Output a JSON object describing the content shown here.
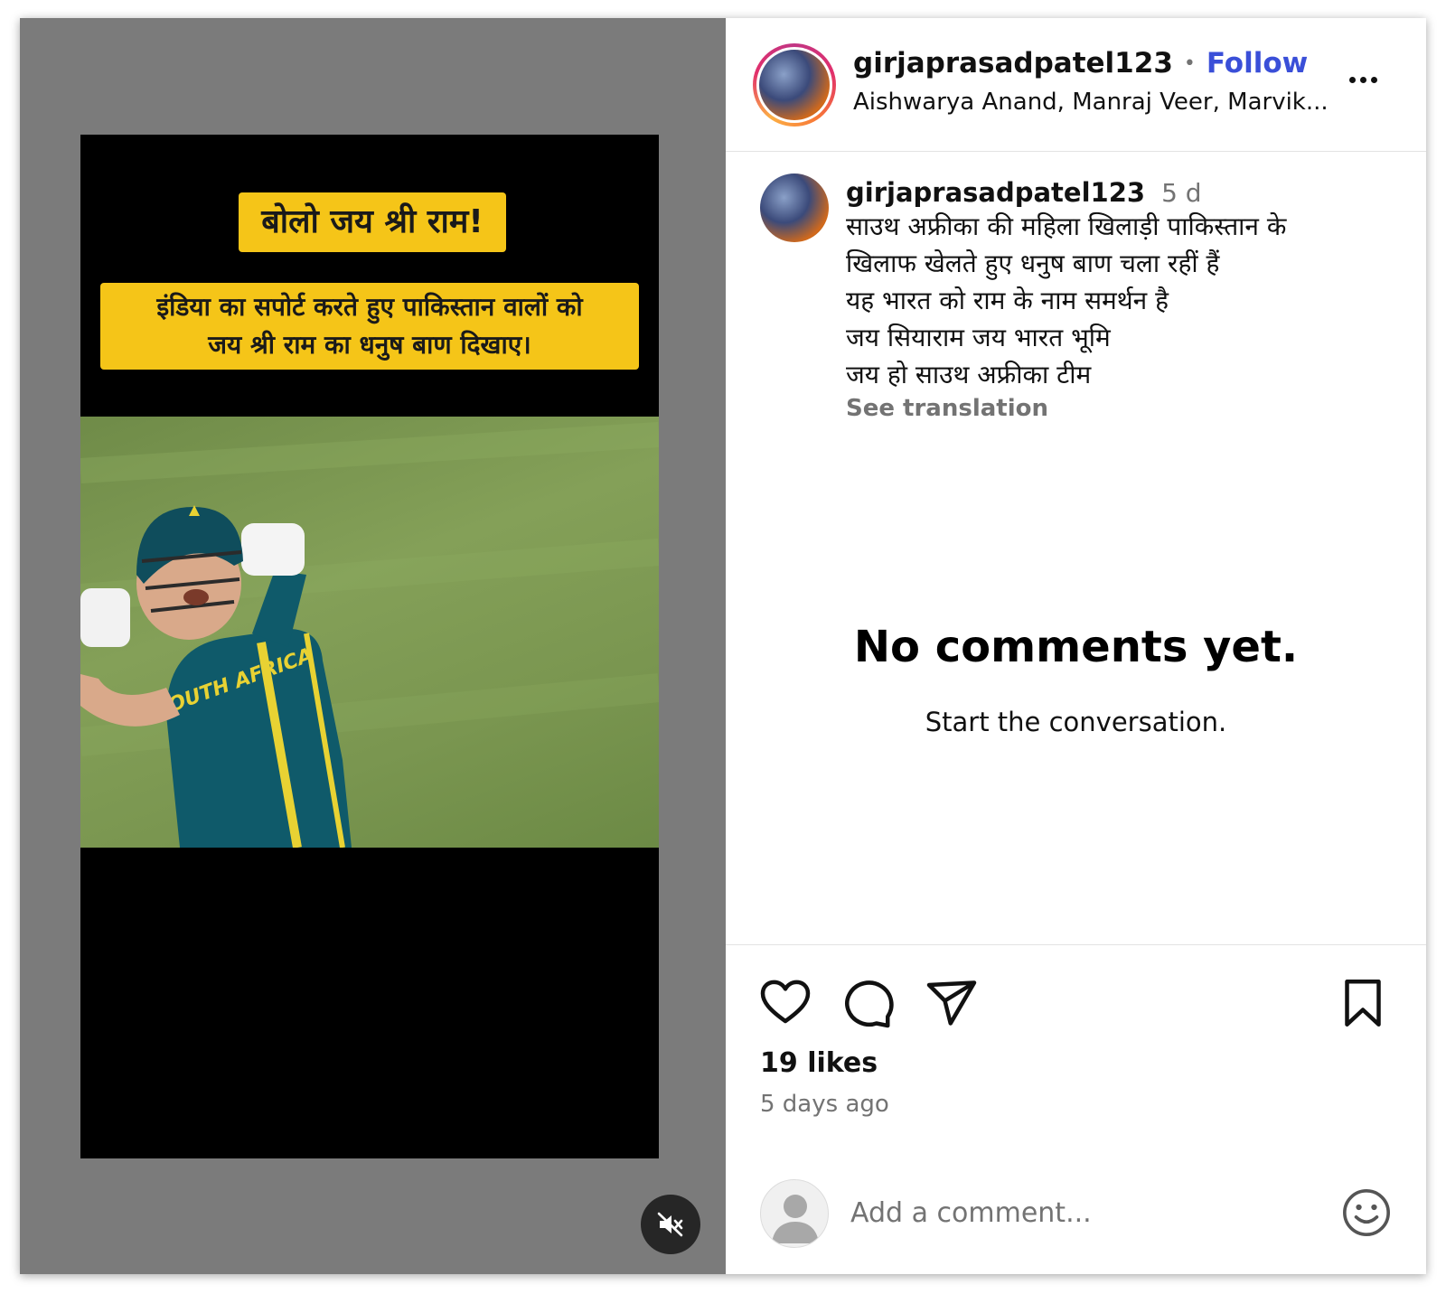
{
  "media": {
    "banner_top": "बोलो जय श्री राम!",
    "banner_bottom_line1": "इंडिया का सपोर्ट करते हुए पाकिस्तान वालों को",
    "banner_bottom_line2": "जय श्री राम का धनुष बाण दिखाए।",
    "jersey_text": "SOUTH AFRICA",
    "mute_icon": "speaker-muted-icon"
  },
  "header": {
    "username": "girjaprasadpatel123",
    "separator": "•",
    "follow_label": "Follow",
    "audio_attribution": "Aishwarya Anand, Manraj Veer, Marvik...",
    "more_icon": "ellipsis-icon"
  },
  "caption": {
    "username": "girjaprasadpatel123",
    "time": "5 d",
    "lines": [
      "साउथ अफ्रीका की महिला खिलाड़ी पाकिस्तान के",
      "खिलाफ खेलते हुए धनुष बाण चला रहीं हैं",
      "यह भारत को राम के नाम समर्थन है",
      "जय सियाराम जय भारत भूमि",
      "जय हो साउथ अफ्रीका टीम"
    ],
    "see_translation": "See translation"
  },
  "comments": {
    "empty_title": "No comments yet.",
    "empty_subtitle": "Start the conversation."
  },
  "actions": {
    "icons": [
      "heart-icon",
      "comment-icon",
      "share-icon",
      "bookmark-icon"
    ],
    "likes": "19 likes",
    "time_ago": "5 days ago"
  },
  "comment_box": {
    "placeholder": "Add a comment...",
    "emoji_icon": "emoji-icon"
  },
  "colors": {
    "follow": "#3a4fd8",
    "banner": "#f5c518",
    "media_background": "#7b7b7b"
  }
}
